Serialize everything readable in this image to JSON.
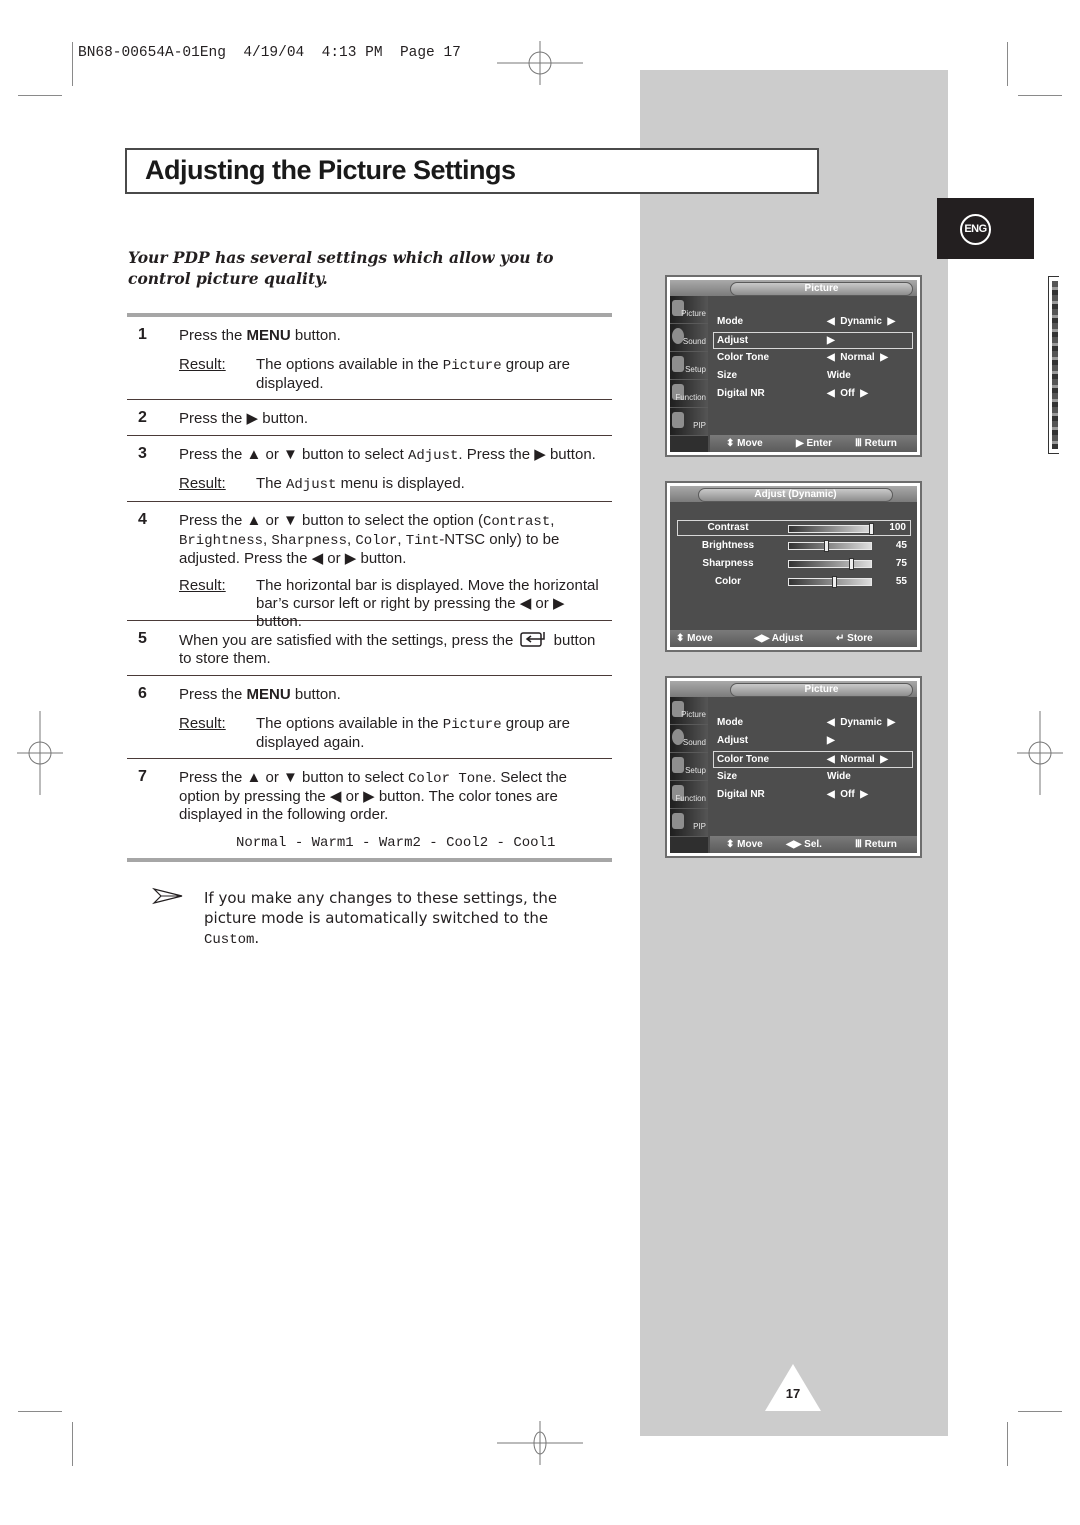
{
  "print_header": "BN68-00654A-01Eng  4/19/04  4:13 PM  Page 17",
  "title": "Adjusting the Picture Settings",
  "intro": "Your PDP has several settings which allow you to control picture quality.",
  "result_label": "Result",
  "steps": [
    {
      "num": "1",
      "parts": [
        "Press the ",
        "MENU",
        " button."
      ],
      "result": [
        "The options available in the ",
        "Picture",
        " group are displayed."
      ]
    },
    {
      "num": "2",
      "text": "Press the ▶ button."
    },
    {
      "num": "3",
      "parts": [
        "Press the ▲ or ▼ button to select ",
        "Adjust",
        ". Press the ▶ button."
      ],
      "result": [
        "The ",
        "Adjust",
        " menu is displayed."
      ]
    },
    {
      "num": "4",
      "parts": [
        "Press the ▲ or ▼ button to select the option (",
        "Contrast",
        ", ",
        "Brightness",
        ", ",
        "Sharpness",
        ", ",
        "Color",
        ", ",
        "Tint",
        "-NTSC only) to be adjusted. Press the ◀ or ▶ button."
      ],
      "result": [
        "The horizontal bar is displayed. Move the horizontal bar’s cursor left or right by pressing the ◀ or ▶ button."
      ]
    },
    {
      "num": "5",
      "parts": [
        "When you are satisfied with the settings, press the ",
        "enter-icon",
        " button to store them."
      ]
    },
    {
      "num": "6",
      "parts": [
        "Press the ",
        "MENU",
        " button."
      ],
      "result": [
        "The options available in the ",
        "Picture",
        " group are displayed again."
      ]
    },
    {
      "num": "7",
      "parts": [
        "Press the ▲ or ▼ button to select ",
        "Color Tone",
        ". Select the option by pressing the ◀ or ▶ button. The color tones are displayed in the following order."
      ]
    }
  ],
  "color_tones": [
    "Normal",
    "Warm1",
    "Warm2",
    "Cool2",
    "Cool1"
  ],
  "tone_separator": " - ",
  "note": {
    "text_before": "If you make any changes to these settings, the picture mode is automatically switched to the ",
    "code": "Custom",
    "text_after": "."
  },
  "lang_badge": "ENG",
  "page_number": "17",
  "osd_sidebar": [
    "Picture",
    "Sound",
    "Setup",
    "Function",
    "PIP"
  ],
  "osd1": {
    "title": "Picture",
    "rows": [
      {
        "key": "Mode",
        "value": "◀  Dynamic  ▶"
      },
      {
        "key": "Adjust",
        "value": "▶",
        "selected": true
      },
      {
        "key": "Color Tone",
        "value": "◀  Normal  ▶"
      },
      {
        "key": "Size",
        "value": "Wide"
      },
      {
        "key": "Digital NR",
        "value": "◀  Off  ▶"
      }
    ],
    "footer": [
      "⬍ Move",
      "▶ Enter",
      "Ⅲ Return"
    ]
  },
  "osd2": {
    "title": "Adjust (Dynamic)",
    "rows": [
      {
        "key": "Contrast",
        "value": 100,
        "selected": true
      },
      {
        "key": "Brightness",
        "value": 45
      },
      {
        "key": "Sharpness",
        "value": 75
      },
      {
        "key": "Color",
        "value": 55
      }
    ],
    "max": 100,
    "footer": [
      "⬍ Move",
      "◀▶ Adjust",
      "↵ Store"
    ]
  },
  "osd3": {
    "title": "Picture",
    "rows": [
      {
        "key": "Mode",
        "value": "◀  Dynamic  ▶"
      },
      {
        "key": "Adjust",
        "value": "▶"
      },
      {
        "key": "Color Tone",
        "value": "◀  Normal  ▶",
        "selected": true
      },
      {
        "key": "Size",
        "value": "Wide"
      },
      {
        "key": "Digital NR",
        "value": "◀  Off  ▶"
      }
    ],
    "footer": [
      "⬍ Move",
      "◀▶ Sel.",
      "Ⅲ Return"
    ]
  }
}
